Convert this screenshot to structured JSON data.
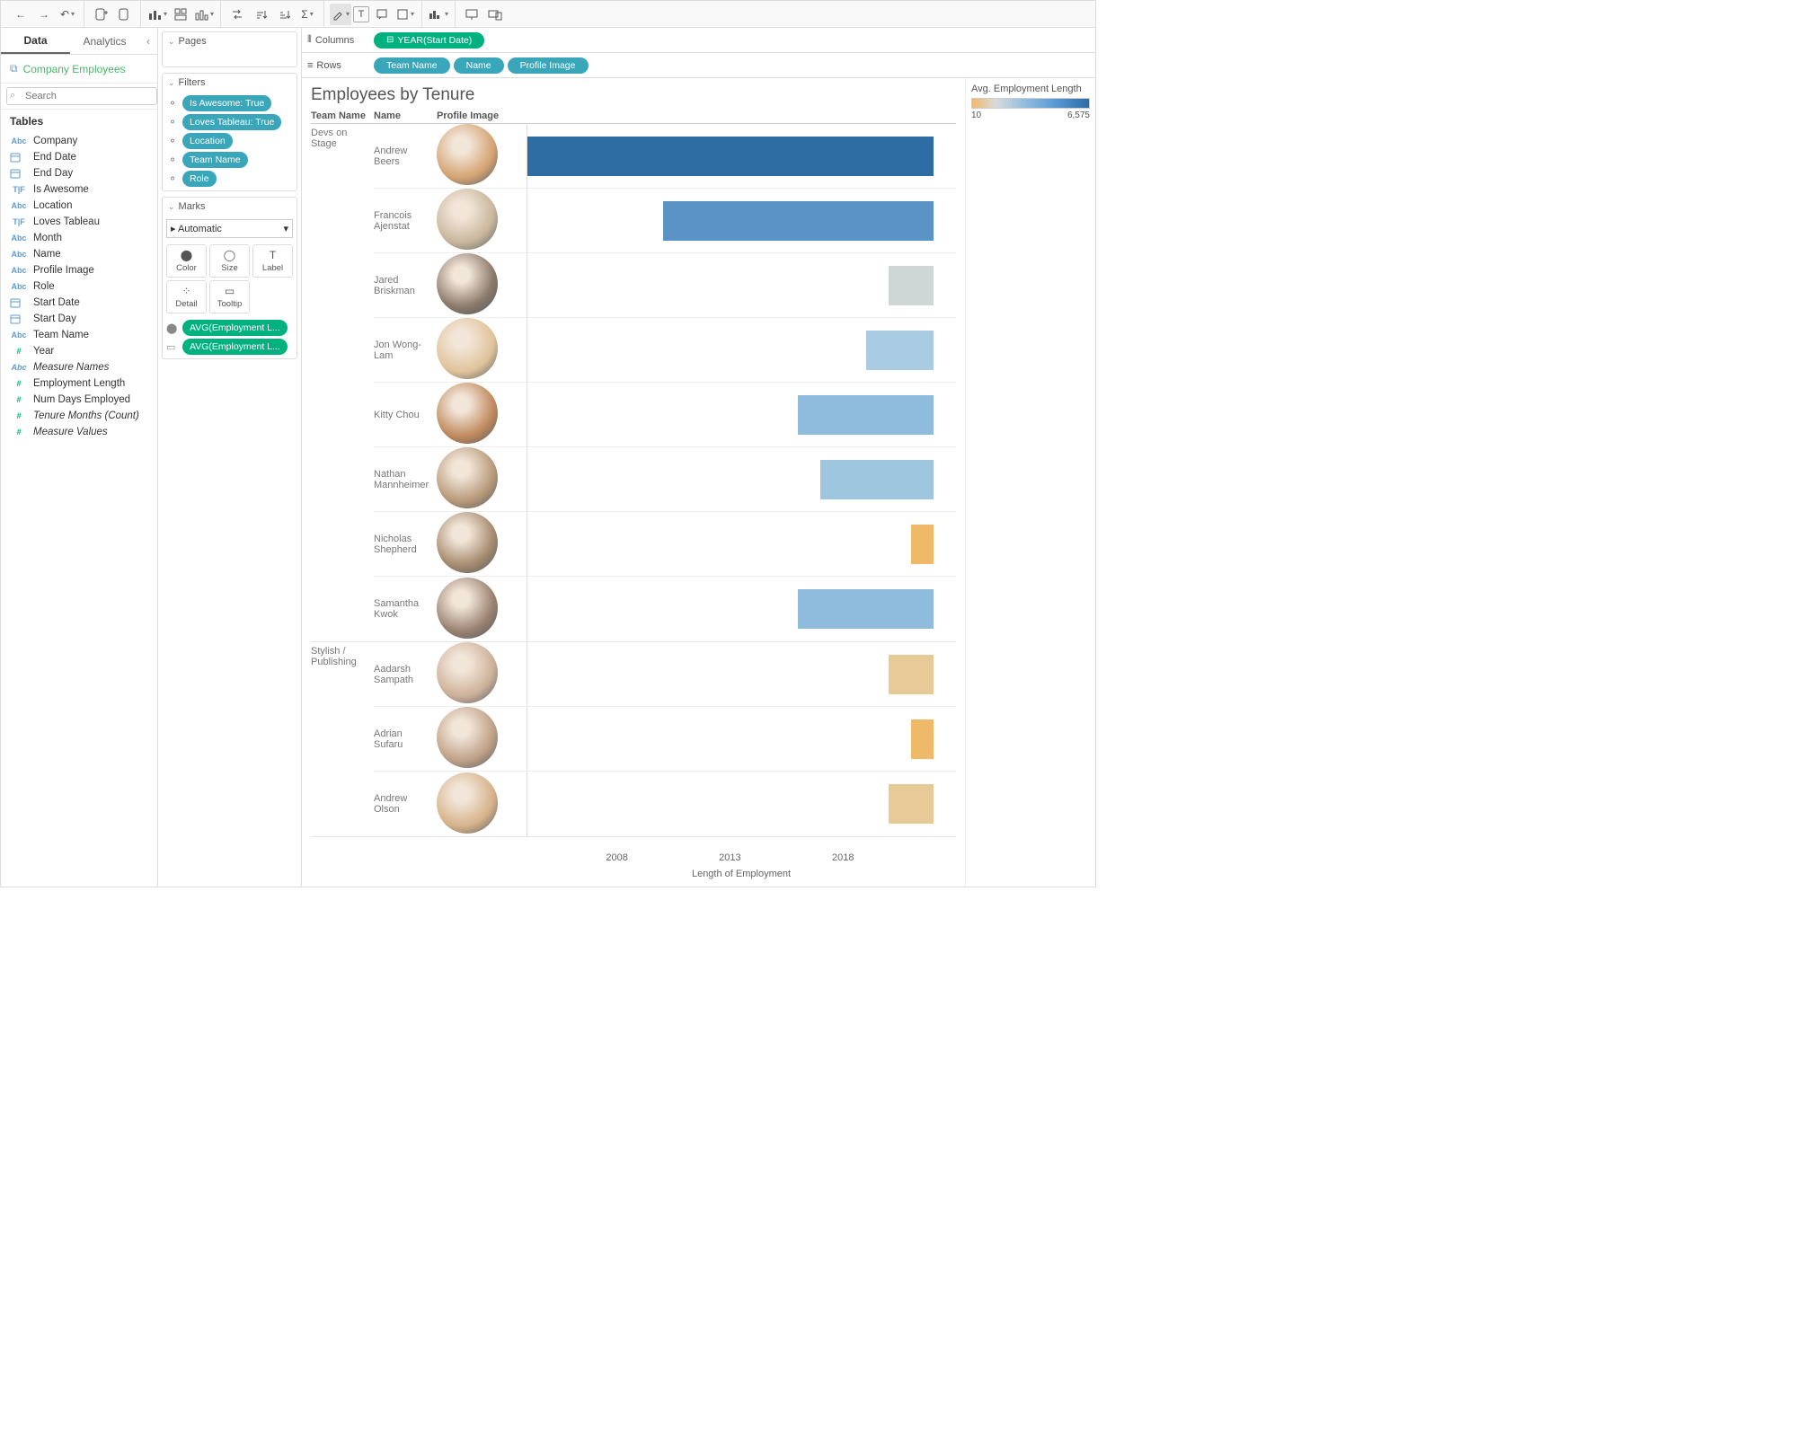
{
  "toolbar_groups": [
    [
      "back-icon",
      "forward-icon",
      "undo-redo-icon"
    ],
    [
      "new-datasource-icon",
      "duplicate-datasource-icon"
    ],
    [
      "new-sheet-icon",
      "new-dashboard-icon",
      "new-story-icon"
    ],
    [
      "swap-icon",
      "sort-asc-icon",
      "sort-desc-icon",
      "totals-icon"
    ],
    [
      "highlight-icon",
      "text-icon",
      "annotate-icon",
      "format-icon"
    ],
    [
      "fit-icon"
    ],
    [
      "presentation-icon",
      "device-preview-icon"
    ]
  ],
  "sidebar": {
    "tabs": [
      "Data",
      "Analytics"
    ],
    "datasource": "Company Employees",
    "search_placeholder": "Search",
    "tables_header": "Tables",
    "fields": [
      {
        "type": "abc",
        "label": "Company"
      },
      {
        "type": "date",
        "label": "End Date"
      },
      {
        "type": "date",
        "label": "End Day"
      },
      {
        "type": "tf",
        "label": "Is Awesome"
      },
      {
        "type": "abc",
        "label": "Location"
      },
      {
        "type": "tf",
        "label": "Loves Tableau"
      },
      {
        "type": "abc",
        "label": "Month"
      },
      {
        "type": "abc",
        "label": "Name"
      },
      {
        "type": "abc",
        "label": "Profile Image"
      },
      {
        "type": "abc",
        "label": "Role"
      },
      {
        "type": "date",
        "label": "Start Date"
      },
      {
        "type": "date",
        "label": "Start Day"
      },
      {
        "type": "abc",
        "label": "Team Name"
      },
      {
        "type": "hash",
        "label": "Year"
      },
      {
        "type": "abc",
        "label": "Measure Names",
        "italic": true
      },
      {
        "type": "hash",
        "label": "Employment Length",
        "calc": true
      },
      {
        "type": "hash",
        "label": "Num Days Employed",
        "calc": true
      },
      {
        "type": "hash",
        "label": "Tenure Months (Count)",
        "italic": true,
        "calc": true
      },
      {
        "type": "hash",
        "label": "Measure Values",
        "italic": true,
        "calc": true
      }
    ]
  },
  "cards": {
    "pages": "Pages",
    "filters_hdr": "Filters",
    "filters": [
      "Is Awesome: True",
      "Loves Tableau: True",
      "Location",
      "Team Name",
      "Role"
    ],
    "marks_hdr": "Marks",
    "marks_type": "Automatic",
    "mark_buttons": [
      "Color",
      "Size",
      "Label",
      "Detail",
      "Tooltip"
    ],
    "mark_pills": [
      "AVG(Employment L...",
      "AVG(Employment L..."
    ]
  },
  "shelves": {
    "columns_lbl": "Columns",
    "rows_lbl": "Rows",
    "columns": [
      {
        "label": "YEAR(Start Date)",
        "green": true
      }
    ],
    "rows": [
      {
        "label": "Team Name"
      },
      {
        "label": "Name"
      },
      {
        "label": "Profile Image"
      }
    ]
  },
  "chart_data": {
    "type": "bar",
    "title": "Employees by Tenure",
    "headers": [
      "Team Name",
      "Name",
      "Profile Image"
    ],
    "xlabel": "Length of Employment",
    "xticks": [
      2008,
      2013,
      2018
    ],
    "xrange": [
      2004,
      2023
    ],
    "legend_title": "Avg. Employment Length",
    "legend_min": "10",
    "legend_max": "6,575",
    "teams": [
      {
        "team": "Devs on Stage",
        "rows": [
          {
            "name": "Andrew Beers",
            "start": 2004,
            "end": 2022,
            "color": "#2e6ca4"
          },
          {
            "name": "Francois Ajenstat",
            "start": 2010,
            "end": 2022,
            "color": "#5b93c6"
          },
          {
            "name": "Jared Briskman",
            "start": 2020,
            "end": 2022,
            "color": "#cfd6d6"
          },
          {
            "name": "Jon Wong-Lam",
            "start": 2019,
            "end": 2022,
            "color": "#a9cce3"
          },
          {
            "name": "Kitty Chou",
            "start": 2016,
            "end": 2022,
            "color": "#8fbcdd"
          },
          {
            "name": "Nathan Mannheimer",
            "start": 2017,
            "end": 2022,
            "color": "#9fc6df"
          },
          {
            "name": "Nicholas Shepherd",
            "start": 2021,
            "end": 2022,
            "color": "#f0b969"
          },
          {
            "name": "Samantha Kwok",
            "start": 2016,
            "end": 2022,
            "color": "#8fbcdd"
          }
        ]
      },
      {
        "team": "Stylish / Publishing",
        "rows": [
          {
            "name": "Aadarsh Sampath",
            "start": 2020,
            "end": 2022,
            "color": "#e8c998"
          },
          {
            "name": "Adrian Sufaru",
            "start": 2021,
            "end": 2022,
            "color": "#f0b969"
          },
          {
            "name": "Andrew Olson",
            "start": 2020,
            "end": 2022,
            "color": "#e8c998"
          }
        ]
      }
    ]
  }
}
